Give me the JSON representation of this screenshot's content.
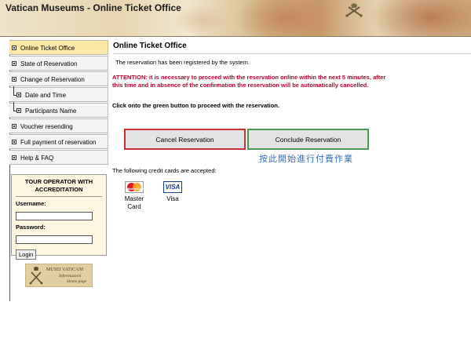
{
  "header": {
    "title": "Vatican Museums - Online Ticket Office",
    "crest_icon": "papal-crest-icon"
  },
  "sidebar": {
    "items": [
      {
        "label": "Online Ticket Office",
        "active": true
      },
      {
        "label": "State of Reservation"
      },
      {
        "label": "Change of Reservation"
      },
      {
        "label": "Date and Time",
        "sub": true
      },
      {
        "label": "Participants Name",
        "sub": true
      },
      {
        "label": "Voucher resending"
      },
      {
        "label": "Full payment of reservation"
      },
      {
        "label": "Help & FAQ"
      }
    ],
    "login": {
      "heading": "TOUR OPERATOR WITH ACCREDITATION",
      "username_label": "Username:",
      "username_value": "",
      "password_label": "Password:",
      "password_value": "",
      "button": "Login"
    },
    "logo": {
      "line1": "MUSEI VATICANI",
      "line2": "Informazioni",
      "line3": "Home page"
    }
  },
  "main": {
    "title": "Online Ticket Office",
    "message": "The reservation has been registered by the system.",
    "attention": "ATTENTION: it is necessary to proceed with the reservation online within the next 5 minutes, after this time and in absence of the confirmation the reservation will be automatically cancelled.",
    "instruction": "Click onto the green button to proceed with the reservation.",
    "cancel_button": "Cancel Reservation",
    "conclude_button": "Conclude Reservation",
    "annotation": "按此開始進行付費作業",
    "cards_note": "The following credit cards are accepted:",
    "cards": [
      {
        "name": "Master Card",
        "line1": "Master",
        "line2": "Card",
        "icon": "mastercard-icon"
      },
      {
        "name": "Visa",
        "icon": "visa-icon"
      }
    ],
    "colors": {
      "attention": "#b3002d",
      "cancel_border": "#c83232",
      "conclude_border": "#4a9a52",
      "annotation": "#3b6fb0",
      "active_nav": "#fce9a8"
    }
  }
}
